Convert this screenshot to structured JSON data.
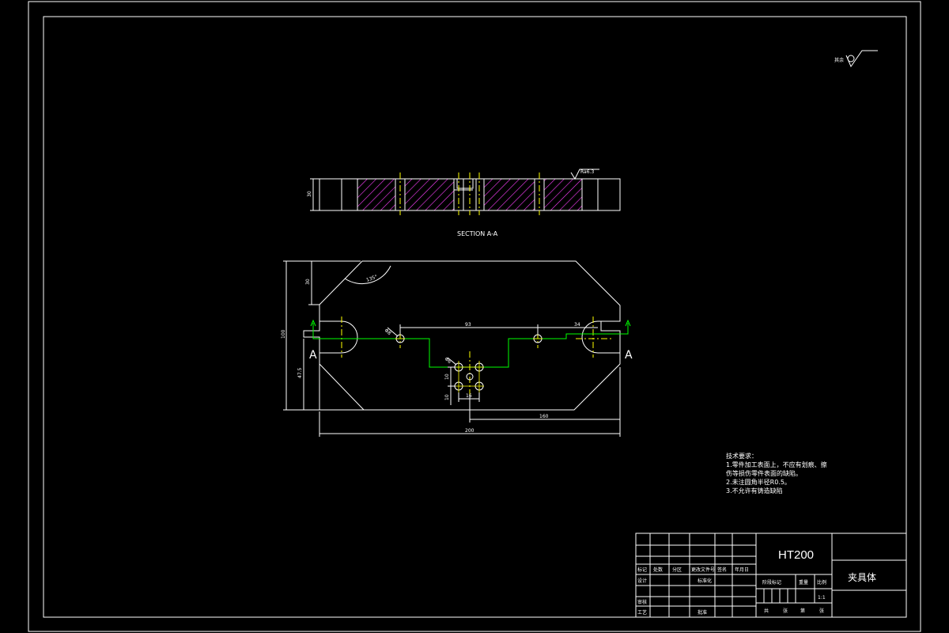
{
  "surface_finish_top": "其余",
  "surface_finish_section": "Ra6.3",
  "section_label": "SECTION A-A",
  "section_view": {
    "dim_height": "30"
  },
  "plan_view": {
    "cut_mark_left": "A",
    "cut_mark_right": "A",
    "dim_overall_width": "200",
    "dim_right_part": "160",
    "dim_overall_height": "100",
    "dim_lower_height": "47.5",
    "dim_corner_height": "30",
    "dim_angle": "135°",
    "dim_hole_spacing": "93",
    "dim_right_gap": "34",
    "dim_small_a": "10",
    "dim_small_b": "10",
    "dim_small_c": "16",
    "dim_hole_callout_left": "Φ8",
    "dim_hole_callout_pattern": "Φ6"
  },
  "technical_requirements": {
    "heading": "技术要求：",
    "lines": [
      "1.零件加工表面上，不应有划痕、擦",
      "伤等损伤零件表面的缺陷。",
      "2.未注圆角半径R0.5。",
      "3.不允许有铸造缺陷"
    ]
  },
  "title_block": {
    "material": "HT200",
    "part_name": "夹具体",
    "labels": {
      "mark": "标记",
      "count": "处数",
      "zone": "分区",
      "change_doc": "更改文件号",
      "signature": "签名",
      "date": "年月日",
      "design": "设计",
      "standardize": "标准化",
      "review": "审核",
      "process": "工艺",
      "approve": "批准",
      "stage_mark": "阶段标记",
      "weight": "重量",
      "scale": "比例",
      "sheets_total": "共",
      "sheets_word": "张",
      "sheet_no": "第",
      "sheet_word2": "张"
    },
    "scale_value": "1:1"
  }
}
